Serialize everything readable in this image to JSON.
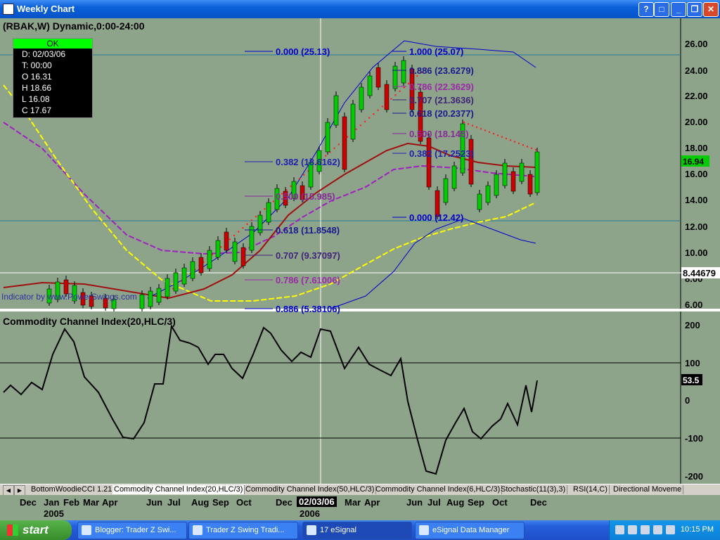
{
  "window": {
    "title": "Weekly Chart"
  },
  "chart_header": "(RBAK,W) Dynamic,0:00-24:00",
  "ohlc_box": {
    "status": "OK",
    "rows": [
      "D: 02/03/06",
      "T: 00:00",
      "O 16.31",
      "H 18.66",
      "L 16.08",
      "C 17.67"
    ]
  },
  "price_axis": {
    "ticks": [
      "26.00",
      "24.00",
      "22.00",
      "20.00",
      "18.00",
      "16.00",
      "14.00",
      "12.00",
      "10.00",
      "8.00",
      "6.00"
    ],
    "crosshair_value": "8.44679",
    "last_price": "16.94"
  },
  "fib_levels": {
    "upper_set": [
      {
        "label": "0.000 (25.13)",
        "color": "#0000cc"
      },
      {
        "label": "0.382 (18.6162)",
        "color": "#2020b0"
      },
      {
        "label": "0.500 (15.985)",
        "color": "#8a2a9a"
      },
      {
        "label": "0.618 (11.8548)",
        "color": "#1a1a90"
      },
      {
        "label": "0.707 (9.37097)",
        "color": "#40237a"
      },
      {
        "label": "0.786 (7.61006)",
        "color": "#9a2aa8"
      },
      {
        "label": "0.886 (5.38106)",
        "color": "#0000cc"
      }
    ],
    "lower_set": [
      {
        "label": "1.000 (25.07)",
        "color": "#0000cc"
      },
      {
        "label": "0.886 (23.6279)",
        "color": "#1a1a90"
      },
      {
        "label": "0.786 (22.3629)",
        "color": "#9a2aa8"
      },
      {
        "label": "0.707 (21.3636)",
        "color": "#40237a"
      },
      {
        "label": "0.618 (20.2377)",
        "color": "#1a1a90"
      },
      {
        "label": "0.500 (18.145)",
        "color": "#8a2a9a"
      },
      {
        "label": "0.382 (17.2523)",
        "color": "#2020b0"
      },
      {
        "label": "0.000 (12.42)",
        "color": "#0000cc"
      }
    ]
  },
  "watermark": "Indicator by www.PowerSwings.com",
  "cci_panel": {
    "title": "Commodity Channel Index(20,HLC/3)",
    "ticks": [
      "200",
      "100",
      "0",
      "-100",
      "-200"
    ],
    "last_value": "53.5"
  },
  "tabs": [
    "BottomWoodieCCI 1.21",
    "Commodity Channel Index(20,HLC/3)",
    "Commodity Channel Index(50,HLC/3)",
    "Commodity Channel Index(6,HLC/3)",
    "Stochastic(11(3),3)",
    "RSI(14,C)",
    "Directional Moveme"
  ],
  "time_axis": {
    "months": [
      "Dec",
      "Jan",
      "Feb",
      "Mar",
      "Apr",
      "Jun",
      "Jul",
      "Aug",
      "Sep",
      "Oct",
      "Dec",
      "Mar",
      "Apr",
      "Jun",
      "Jul",
      "Aug",
      "Sep",
      "Oct",
      "Dec"
    ],
    "years": [
      "2005",
      "2006"
    ],
    "cursor_date": "02/03/06"
  },
  "taskbar": {
    "start": "start",
    "tasks": [
      "Blogger: Trader Z Swi...",
      "Trader Z Swing Tradi...",
      "17 eSignal",
      "eSignal Data Manager"
    ],
    "clock": "10:15 PM"
  },
  "colors": {
    "chart_bg": "#8da38a",
    "up_candle": "#00cc00",
    "down_candle": "#cc0000",
    "ma_red": "#a01010",
    "ma_purple": "#a020c0",
    "ma_yellow": "#ffff00",
    "bollinger": "#0000cc"
  }
}
